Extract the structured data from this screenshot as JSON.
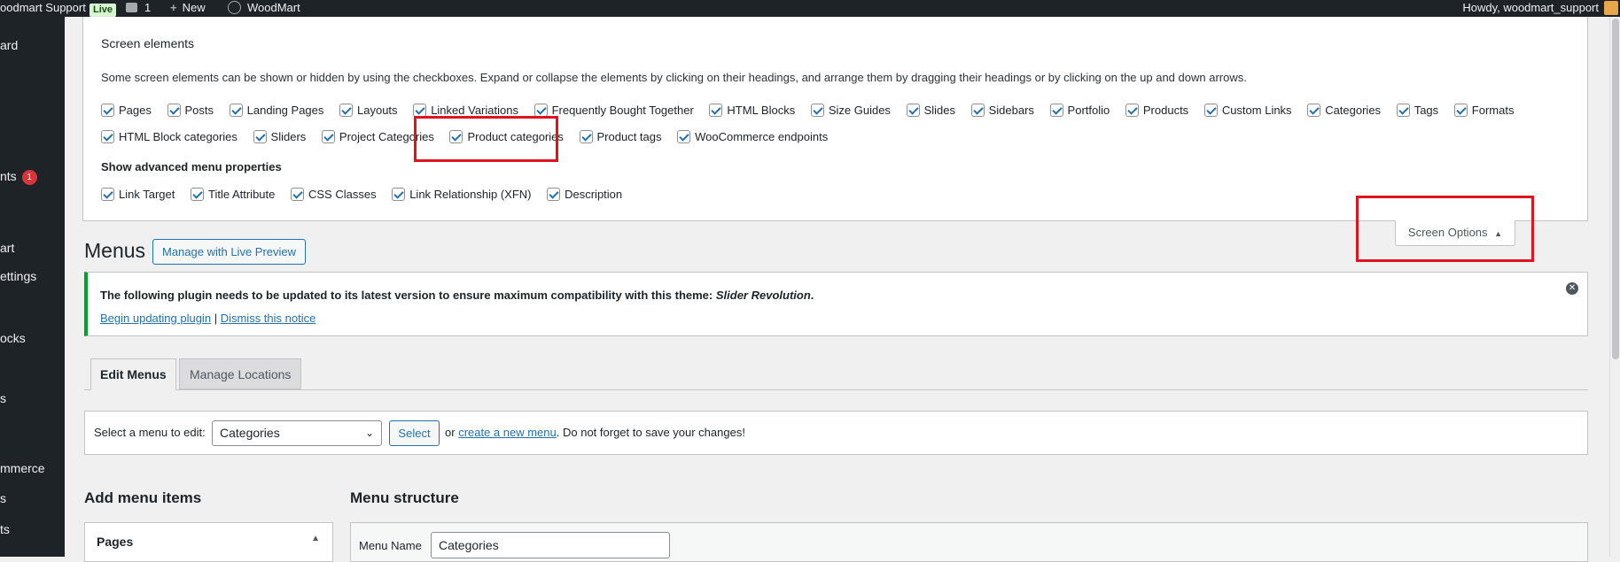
{
  "adminbar": {
    "site_name": "oodmart Support",
    "live_badge": "Live",
    "comments_count": "1",
    "new_label": "New",
    "woodmart_label": "WoodMart",
    "howdy": "Howdy, woodmart_support"
  },
  "sidebar": {
    "items": [
      {
        "label": "ard"
      },
      {
        "label": "nts",
        "badge": "1"
      },
      {
        "label": "art"
      },
      {
        "label": "ettings"
      },
      {
        "label": "ocks"
      },
      {
        "label": "s"
      },
      {
        "label": "mmerce"
      },
      {
        "label": "s"
      },
      {
        "label": "ts"
      }
    ]
  },
  "screen_options": {
    "title": "Screen elements",
    "description": "Some screen elements can be shown or hidden by using the checkboxes. Expand or collapse the elements by clicking on their headings, and arrange them by dragging their headings or by clicking on the up and down arrows.",
    "row1": [
      "Pages",
      "Posts",
      "Landing Pages",
      "Layouts",
      "Linked Variations",
      "Frequently Bought Together",
      "HTML Blocks",
      "Size Guides",
      "Slides",
      "Sidebars",
      "Portfolio",
      "Products",
      "Custom Links",
      "Categories",
      "Tags",
      "Formats"
    ],
    "row2": [
      "HTML Block categories",
      "Sliders",
      "Project Categories",
      "Product categories",
      "Product tags",
      "WooCommerce endpoints"
    ],
    "advanced_title": "Show advanced menu properties",
    "advanced": [
      "Link Target",
      "Title Attribute",
      "CSS Classes",
      "Link Relationship (XFN)",
      "Description"
    ],
    "tab_label": "Screen Options"
  },
  "page": {
    "title": "Menus",
    "live_preview_button": "Manage with Live Preview"
  },
  "notice": {
    "message": "The following plugin needs to be updated to its latest version to ensure maximum compatibility with this theme: ",
    "plugin_name": "Slider Revolution",
    "message_end": ".",
    "begin_link": "Begin updating plugin",
    "separator": "|",
    "dismiss_link": "Dismiss this notice"
  },
  "tabs": {
    "edit": "Edit Menus",
    "manage": "Manage Locations"
  },
  "select_bar": {
    "label": "Select a menu to edit:",
    "selected": "Categories",
    "button": "Select",
    "or": "or",
    "create_link": "create a new menu",
    "tail": ". Do not forget to save your changes!"
  },
  "add_items": {
    "title": "Add menu items",
    "pages_box": "Pages"
  },
  "structure": {
    "title": "Menu structure",
    "name_label": "Menu Name",
    "name_value": "Categories"
  },
  "colors": {
    "accent": "#2271b1",
    "highlight": "#e0131e",
    "notice_border": "#00a32a"
  }
}
